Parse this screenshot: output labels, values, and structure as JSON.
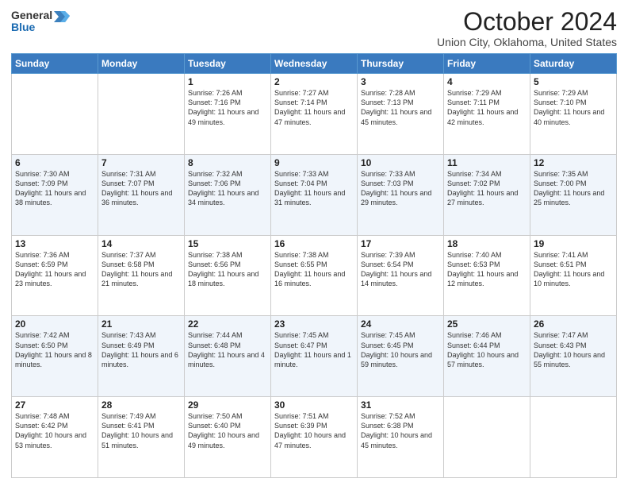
{
  "header": {
    "logo_general": "General",
    "logo_blue": "Blue",
    "month_title": "October 2024",
    "location": "Union City, Oklahoma, United States"
  },
  "calendar": {
    "days_of_week": [
      "Sunday",
      "Monday",
      "Tuesday",
      "Wednesday",
      "Thursday",
      "Friday",
      "Saturday"
    ],
    "rows": [
      [
        {
          "day": "",
          "info": ""
        },
        {
          "day": "",
          "info": ""
        },
        {
          "day": "1",
          "info": "Sunrise: 7:26 AM\nSunset: 7:16 PM\nDaylight: 11 hours and 49 minutes."
        },
        {
          "day": "2",
          "info": "Sunrise: 7:27 AM\nSunset: 7:14 PM\nDaylight: 11 hours and 47 minutes."
        },
        {
          "day": "3",
          "info": "Sunrise: 7:28 AM\nSunset: 7:13 PM\nDaylight: 11 hours and 45 minutes."
        },
        {
          "day": "4",
          "info": "Sunrise: 7:29 AM\nSunset: 7:11 PM\nDaylight: 11 hours and 42 minutes."
        },
        {
          "day": "5",
          "info": "Sunrise: 7:29 AM\nSunset: 7:10 PM\nDaylight: 11 hours and 40 minutes."
        }
      ],
      [
        {
          "day": "6",
          "info": "Sunrise: 7:30 AM\nSunset: 7:09 PM\nDaylight: 11 hours and 38 minutes."
        },
        {
          "day": "7",
          "info": "Sunrise: 7:31 AM\nSunset: 7:07 PM\nDaylight: 11 hours and 36 minutes."
        },
        {
          "day": "8",
          "info": "Sunrise: 7:32 AM\nSunset: 7:06 PM\nDaylight: 11 hours and 34 minutes."
        },
        {
          "day": "9",
          "info": "Sunrise: 7:33 AM\nSunset: 7:04 PM\nDaylight: 11 hours and 31 minutes."
        },
        {
          "day": "10",
          "info": "Sunrise: 7:33 AM\nSunset: 7:03 PM\nDaylight: 11 hours and 29 minutes."
        },
        {
          "day": "11",
          "info": "Sunrise: 7:34 AM\nSunset: 7:02 PM\nDaylight: 11 hours and 27 minutes."
        },
        {
          "day": "12",
          "info": "Sunrise: 7:35 AM\nSunset: 7:00 PM\nDaylight: 11 hours and 25 minutes."
        }
      ],
      [
        {
          "day": "13",
          "info": "Sunrise: 7:36 AM\nSunset: 6:59 PM\nDaylight: 11 hours and 23 minutes."
        },
        {
          "day": "14",
          "info": "Sunrise: 7:37 AM\nSunset: 6:58 PM\nDaylight: 11 hours and 21 minutes."
        },
        {
          "day": "15",
          "info": "Sunrise: 7:38 AM\nSunset: 6:56 PM\nDaylight: 11 hours and 18 minutes."
        },
        {
          "day": "16",
          "info": "Sunrise: 7:38 AM\nSunset: 6:55 PM\nDaylight: 11 hours and 16 minutes."
        },
        {
          "day": "17",
          "info": "Sunrise: 7:39 AM\nSunset: 6:54 PM\nDaylight: 11 hours and 14 minutes."
        },
        {
          "day": "18",
          "info": "Sunrise: 7:40 AM\nSunset: 6:53 PM\nDaylight: 11 hours and 12 minutes."
        },
        {
          "day": "19",
          "info": "Sunrise: 7:41 AM\nSunset: 6:51 PM\nDaylight: 11 hours and 10 minutes."
        }
      ],
      [
        {
          "day": "20",
          "info": "Sunrise: 7:42 AM\nSunset: 6:50 PM\nDaylight: 11 hours and 8 minutes."
        },
        {
          "day": "21",
          "info": "Sunrise: 7:43 AM\nSunset: 6:49 PM\nDaylight: 11 hours and 6 minutes."
        },
        {
          "day": "22",
          "info": "Sunrise: 7:44 AM\nSunset: 6:48 PM\nDaylight: 11 hours and 4 minutes."
        },
        {
          "day": "23",
          "info": "Sunrise: 7:45 AM\nSunset: 6:47 PM\nDaylight: 11 hours and 1 minute."
        },
        {
          "day": "24",
          "info": "Sunrise: 7:45 AM\nSunset: 6:45 PM\nDaylight: 10 hours and 59 minutes."
        },
        {
          "day": "25",
          "info": "Sunrise: 7:46 AM\nSunset: 6:44 PM\nDaylight: 10 hours and 57 minutes."
        },
        {
          "day": "26",
          "info": "Sunrise: 7:47 AM\nSunset: 6:43 PM\nDaylight: 10 hours and 55 minutes."
        }
      ],
      [
        {
          "day": "27",
          "info": "Sunrise: 7:48 AM\nSunset: 6:42 PM\nDaylight: 10 hours and 53 minutes."
        },
        {
          "day": "28",
          "info": "Sunrise: 7:49 AM\nSunset: 6:41 PM\nDaylight: 10 hours and 51 minutes."
        },
        {
          "day": "29",
          "info": "Sunrise: 7:50 AM\nSunset: 6:40 PM\nDaylight: 10 hours and 49 minutes."
        },
        {
          "day": "30",
          "info": "Sunrise: 7:51 AM\nSunset: 6:39 PM\nDaylight: 10 hours and 47 minutes."
        },
        {
          "day": "31",
          "info": "Sunrise: 7:52 AM\nSunset: 6:38 PM\nDaylight: 10 hours and 45 minutes."
        },
        {
          "day": "",
          "info": ""
        },
        {
          "day": "",
          "info": ""
        }
      ]
    ]
  }
}
